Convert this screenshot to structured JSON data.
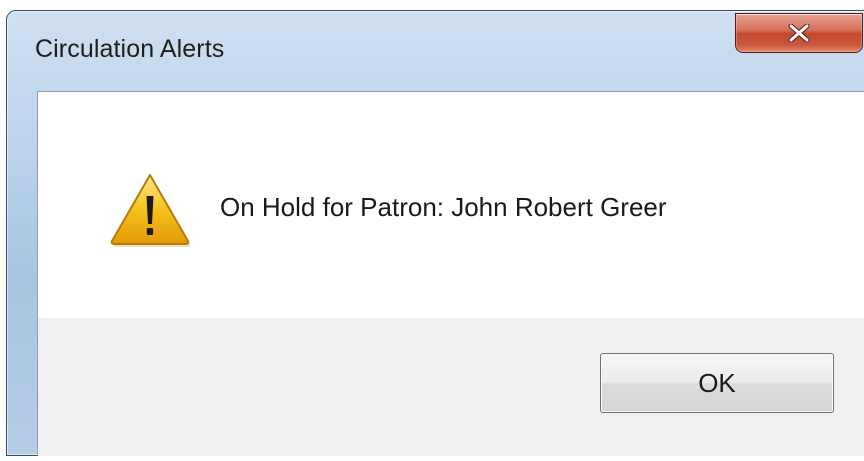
{
  "window": {
    "title": "Circulation Alerts"
  },
  "titlebar": {
    "close_icon": "close-x-icon",
    "close_color": "#c7452a"
  },
  "dialog": {
    "icon": "warning-icon",
    "message": "On Hold for Patron: John Robert Greer",
    "ok_label": "OK"
  },
  "colors": {
    "titlebar": "#b9d1ea",
    "footer": "#f0f0f0",
    "warning_fill": "#f6c21b"
  }
}
